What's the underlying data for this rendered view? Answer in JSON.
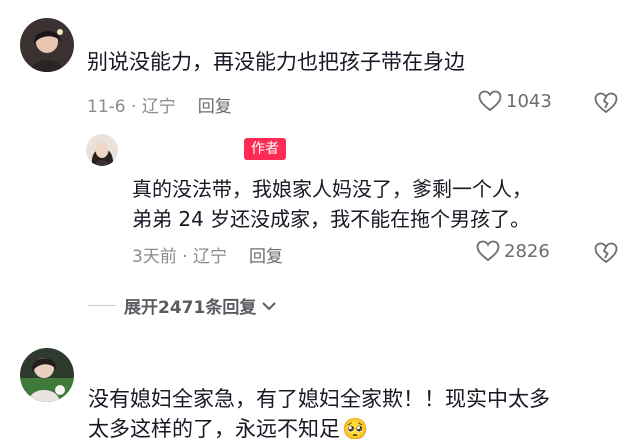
{
  "comments": [
    {
      "text": "别说没能力，再没能力也把孩子带在身边",
      "time_location": "11-6 · 辽宁",
      "reply_label": "回复",
      "likes": "1043",
      "replies": [
        {
          "badge": "作者",
          "text_line1": "真的没法带，我娘家人妈没了，爹剩一个人，",
          "text_line2": "弟弟 24 岁还没成家，我不能在拖个男孩了。",
          "time_location": "3天前 · 辽宁",
          "reply_label": "回复",
          "likes": "2826"
        }
      ],
      "expand_label": "展开2471条回复"
    },
    {
      "text_line1": "没有媳妇全家急，有了媳妇全家欺！！现实中太多",
      "text_line2": "太多这样的了，永远不知足",
      "emoji": "🥺"
    }
  ],
  "colors": {
    "author_badge": "#fe2c55",
    "meta_text": "#8a8b91",
    "body_text": "#161823"
  },
  "icons": [
    "heart-outline-icon",
    "broken-heart-icon",
    "chevron-down-icon"
  ]
}
